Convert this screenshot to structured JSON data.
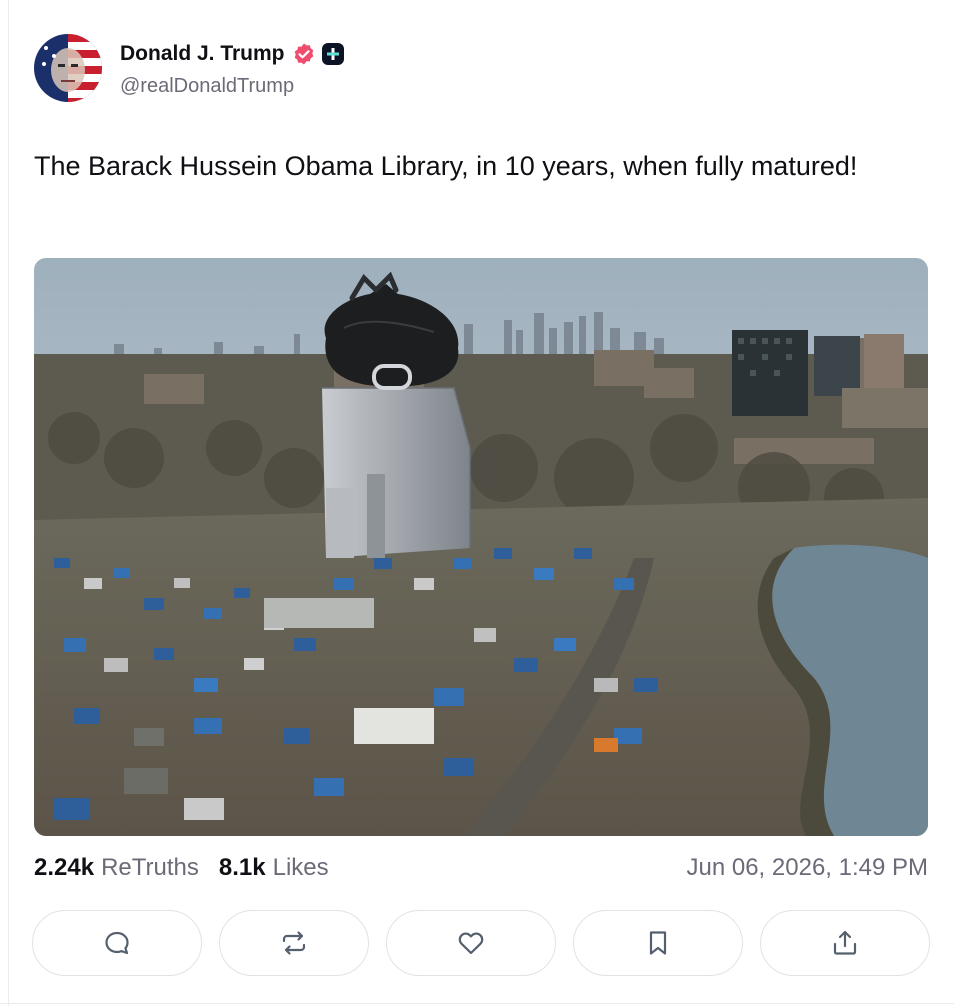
{
  "author": {
    "display_name": "Donald J. Trump",
    "handle": "@realDonaldTrump",
    "verified_icon": "verified-badge-icon",
    "plus_icon": "plus-badge-icon"
  },
  "post": {
    "text": "The Barack Hussein Obama Library, in 10 years, when fully matured!",
    "image_alt": "aerial photo of tower topped with garbage bag amid tent encampment beside river, city skyline behind"
  },
  "stats": {
    "retruths_count": "2.24k",
    "retruths_label": "ReTruths",
    "likes_count": "8.1k",
    "likes_label": "Likes",
    "timestamp": "Jun 06, 2026, 1:49 PM"
  },
  "actions": [
    {
      "icon": "reply-icon"
    },
    {
      "icon": "retruth-icon"
    },
    {
      "icon": "like-icon"
    },
    {
      "icon": "bookmark-icon"
    },
    {
      "icon": "share-icon"
    }
  ],
  "colors": {
    "verified": "#ef4c6e",
    "muted_text": "#6b6b78",
    "border": "#e2e2e8"
  }
}
